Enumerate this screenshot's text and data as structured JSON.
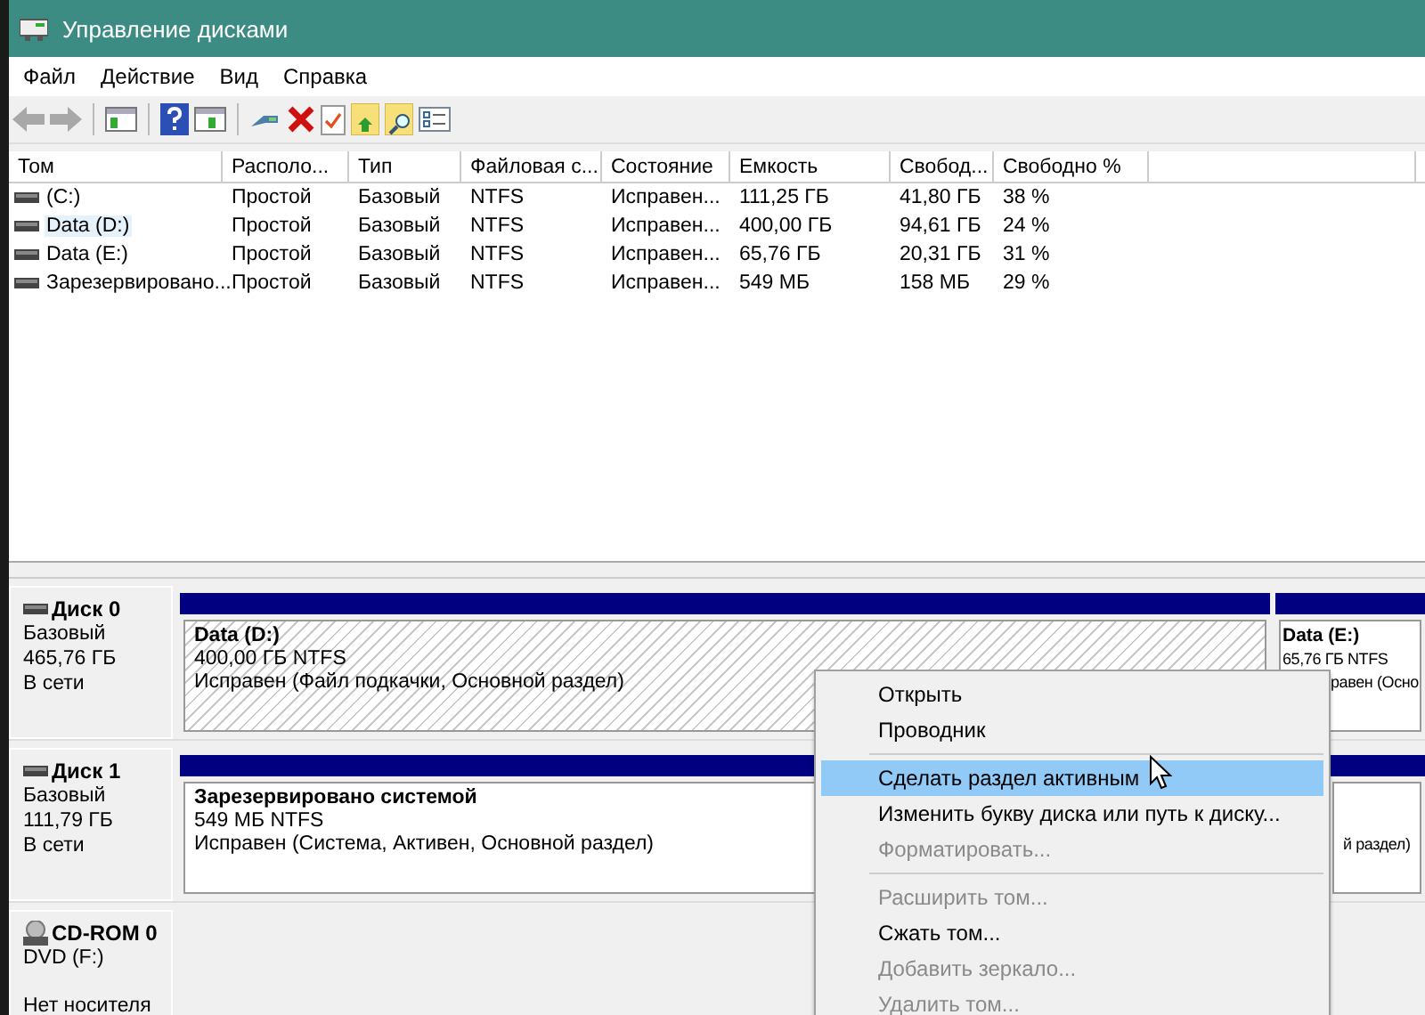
{
  "window": {
    "title": "Управление дисками"
  },
  "menu_bar": [
    "Файл",
    "Действие",
    "Вид",
    "Справка"
  ],
  "toolbar_nav": [
    {
      "disabled": true
    },
    {
      "disabled": true
    }
  ],
  "table": {
    "columns": [
      "Том",
      "Располо...",
      "Тип",
      "Файловая с...",
      "Состояние",
      "Емкость",
      "Свобод...",
      "Свободно %"
    ],
    "rows": [
      {
        "selected": false,
        "cells": [
          " (C:)",
          "Простой",
          "Базовый",
          "NTFS",
          "Исправен...",
          "111,25 ГБ",
          "41,80 ГБ",
          "38 %"
        ]
      },
      {
        "selected": true,
        "cells": [
          "Data (D:)",
          "Простой",
          "Базовый",
          "NTFS",
          "Исправен...",
          "400,00 ГБ",
          "94,61 ГБ",
          "24 %"
        ]
      },
      {
        "selected": false,
        "cells": [
          "Data (E:)",
          "Простой",
          "Базовый",
          "NTFS",
          "Исправен...",
          "65,76 ГБ",
          "20,31 ГБ",
          "31 %"
        ]
      },
      {
        "selected": false,
        "cells": [
          "Зарезервировано...",
          "Простой",
          "Базовый",
          "NTFS",
          "Исправен...",
          "549 МБ",
          "158 МБ",
          "29 %"
        ]
      }
    ]
  },
  "disks": [
    {
      "kind": "hdd",
      "name": "Диск 0",
      "lines": [
        "Базовый",
        "465,76 ГБ",
        "В сети"
      ],
      "partitions": [
        {
          "kind": "main",
          "selected": true,
          "title": "Data  (D:)",
          "size": "400,00 ГБ NTFS",
          "status": "Исправен (Файл подкачки, Основной раздел)"
        },
        {
          "kind": "edge",
          "selected": false,
          "title": "Data  (E:)",
          "size": "65,76 ГБ NTFS",
          "status": "равен (Осно"
        }
      ]
    },
    {
      "kind": "hdd",
      "name": "Диск 1",
      "lines": [
        "Базовый",
        "111,79 ГБ",
        "В сети"
      ],
      "partitions": [
        {
          "kind": "main",
          "selected": false,
          "title": "Зарезервировано системой",
          "size": "549 МБ NTFS",
          "status": "Исправен (Система, Активен, Основной раздел)"
        },
        {
          "kind": "edge",
          "selected": false,
          "status": "й раздел)"
        }
      ]
    },
    {
      "kind": "cdrom",
      "name": "CD-ROM 0",
      "lines": [
        "DVD (F:)",
        "Нет носителя"
      ]
    }
  ],
  "context_menu": [
    {
      "kind": "item",
      "label": "Открыть",
      "disabled": false,
      "selected": false
    },
    {
      "kind": "item",
      "label": "Проводник",
      "disabled": false,
      "selected": false
    },
    {
      "kind": "separator"
    },
    {
      "kind": "item",
      "label": "Сделать раздел активным",
      "disabled": false,
      "selected": true
    },
    {
      "kind": "item",
      "label": "Изменить букву диска или путь к диску...",
      "disabled": false,
      "selected": false
    },
    {
      "kind": "item",
      "label": "Форматировать...",
      "disabled": true,
      "selected": false
    },
    {
      "kind": "separator"
    },
    {
      "kind": "item",
      "label": "Расширить том...",
      "disabled": true,
      "selected": false
    },
    {
      "kind": "item",
      "label": "Сжать том...",
      "disabled": false,
      "selected": false
    },
    {
      "kind": "item",
      "label": "Добавить зеркало...",
      "disabled": true,
      "selected": false
    },
    {
      "kind": "item",
      "label": "Удалить том...",
      "disabled": true,
      "selected": false
    }
  ]
}
